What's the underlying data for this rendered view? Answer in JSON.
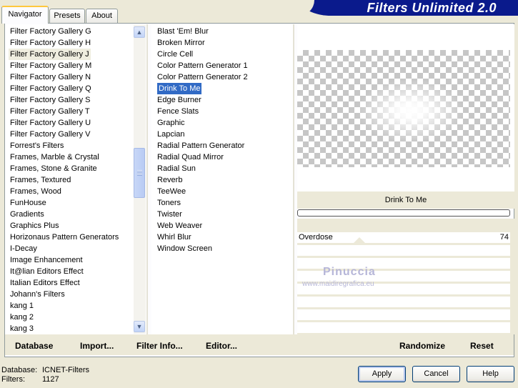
{
  "tabs": [
    "Navigator",
    "Presets",
    "About"
  ],
  "app_title": "Filters Unlimited 2.0",
  "categories": [
    "Filter Factory Gallery G",
    "Filter Factory Gallery H",
    "Filter Factory Gallery J",
    "Filter Factory Gallery M",
    "Filter Factory Gallery N",
    "Filter Factory Gallery Q",
    "Filter Factory Gallery S",
    "Filter Factory Gallery T",
    "Filter Factory Gallery U",
    "Filter Factory Gallery V",
    "Forrest's Filters",
    "Frames, Marble & Crystal",
    "Frames, Stone & Granite",
    "Frames, Textured",
    "Frames, Wood",
    "FunHouse",
    "Gradients",
    "Graphics Plus",
    "Horizonaus Pattern Generators",
    "I-Decay",
    "Image Enhancement",
    "It@lian Editors Effect",
    "Italian Editors Effect",
    "Johann's Filters",
    "kang 1",
    "kang 2",
    "kang 3"
  ],
  "selected_category": "Filter Factory Gallery J",
  "filters": [
    "Blast 'Em! Blur",
    "Broken Mirror",
    "Circle Cell",
    "Color Pattern Generator 1",
    "Color Pattern Generator 2",
    "Drink To Me",
    "Edge Burner",
    "Fence Slats",
    "Graphic",
    "Lapcian",
    "Radial Pattern Generator",
    "Radial Quad Mirror",
    "Radial Sun",
    "Reverb",
    "TeeWee",
    "Toners",
    "Twister",
    "Web Weaver",
    "Whirl Blur",
    "Window Screen"
  ],
  "selected_filter": "Drink To Me",
  "preview": {
    "filter_name": "Drink To Me"
  },
  "params": [
    {
      "label": "Overdose",
      "value": "74"
    }
  ],
  "watermark": {
    "name": "Pinuccia",
    "url": "www.maidiregrafica.eu"
  },
  "toolbar": {
    "database": "Database",
    "import": "Import...",
    "filter_info": "Filter Info...",
    "editor": "Editor...",
    "randomize": "Randomize",
    "reset": "Reset"
  },
  "status": {
    "database_label": "Database:",
    "database_value": "ICNET-Filters",
    "filters_label": "Filters:",
    "filters_value": "1127"
  },
  "buttons": {
    "apply": "Apply",
    "cancel": "Cancel",
    "help": "Help"
  },
  "scroll_icons": {
    "up": "chevron-up-icon",
    "down": "chevron-down-icon"
  },
  "colors": {
    "selection": "#316ac5",
    "brand_bar": "#0a1a8c"
  }
}
